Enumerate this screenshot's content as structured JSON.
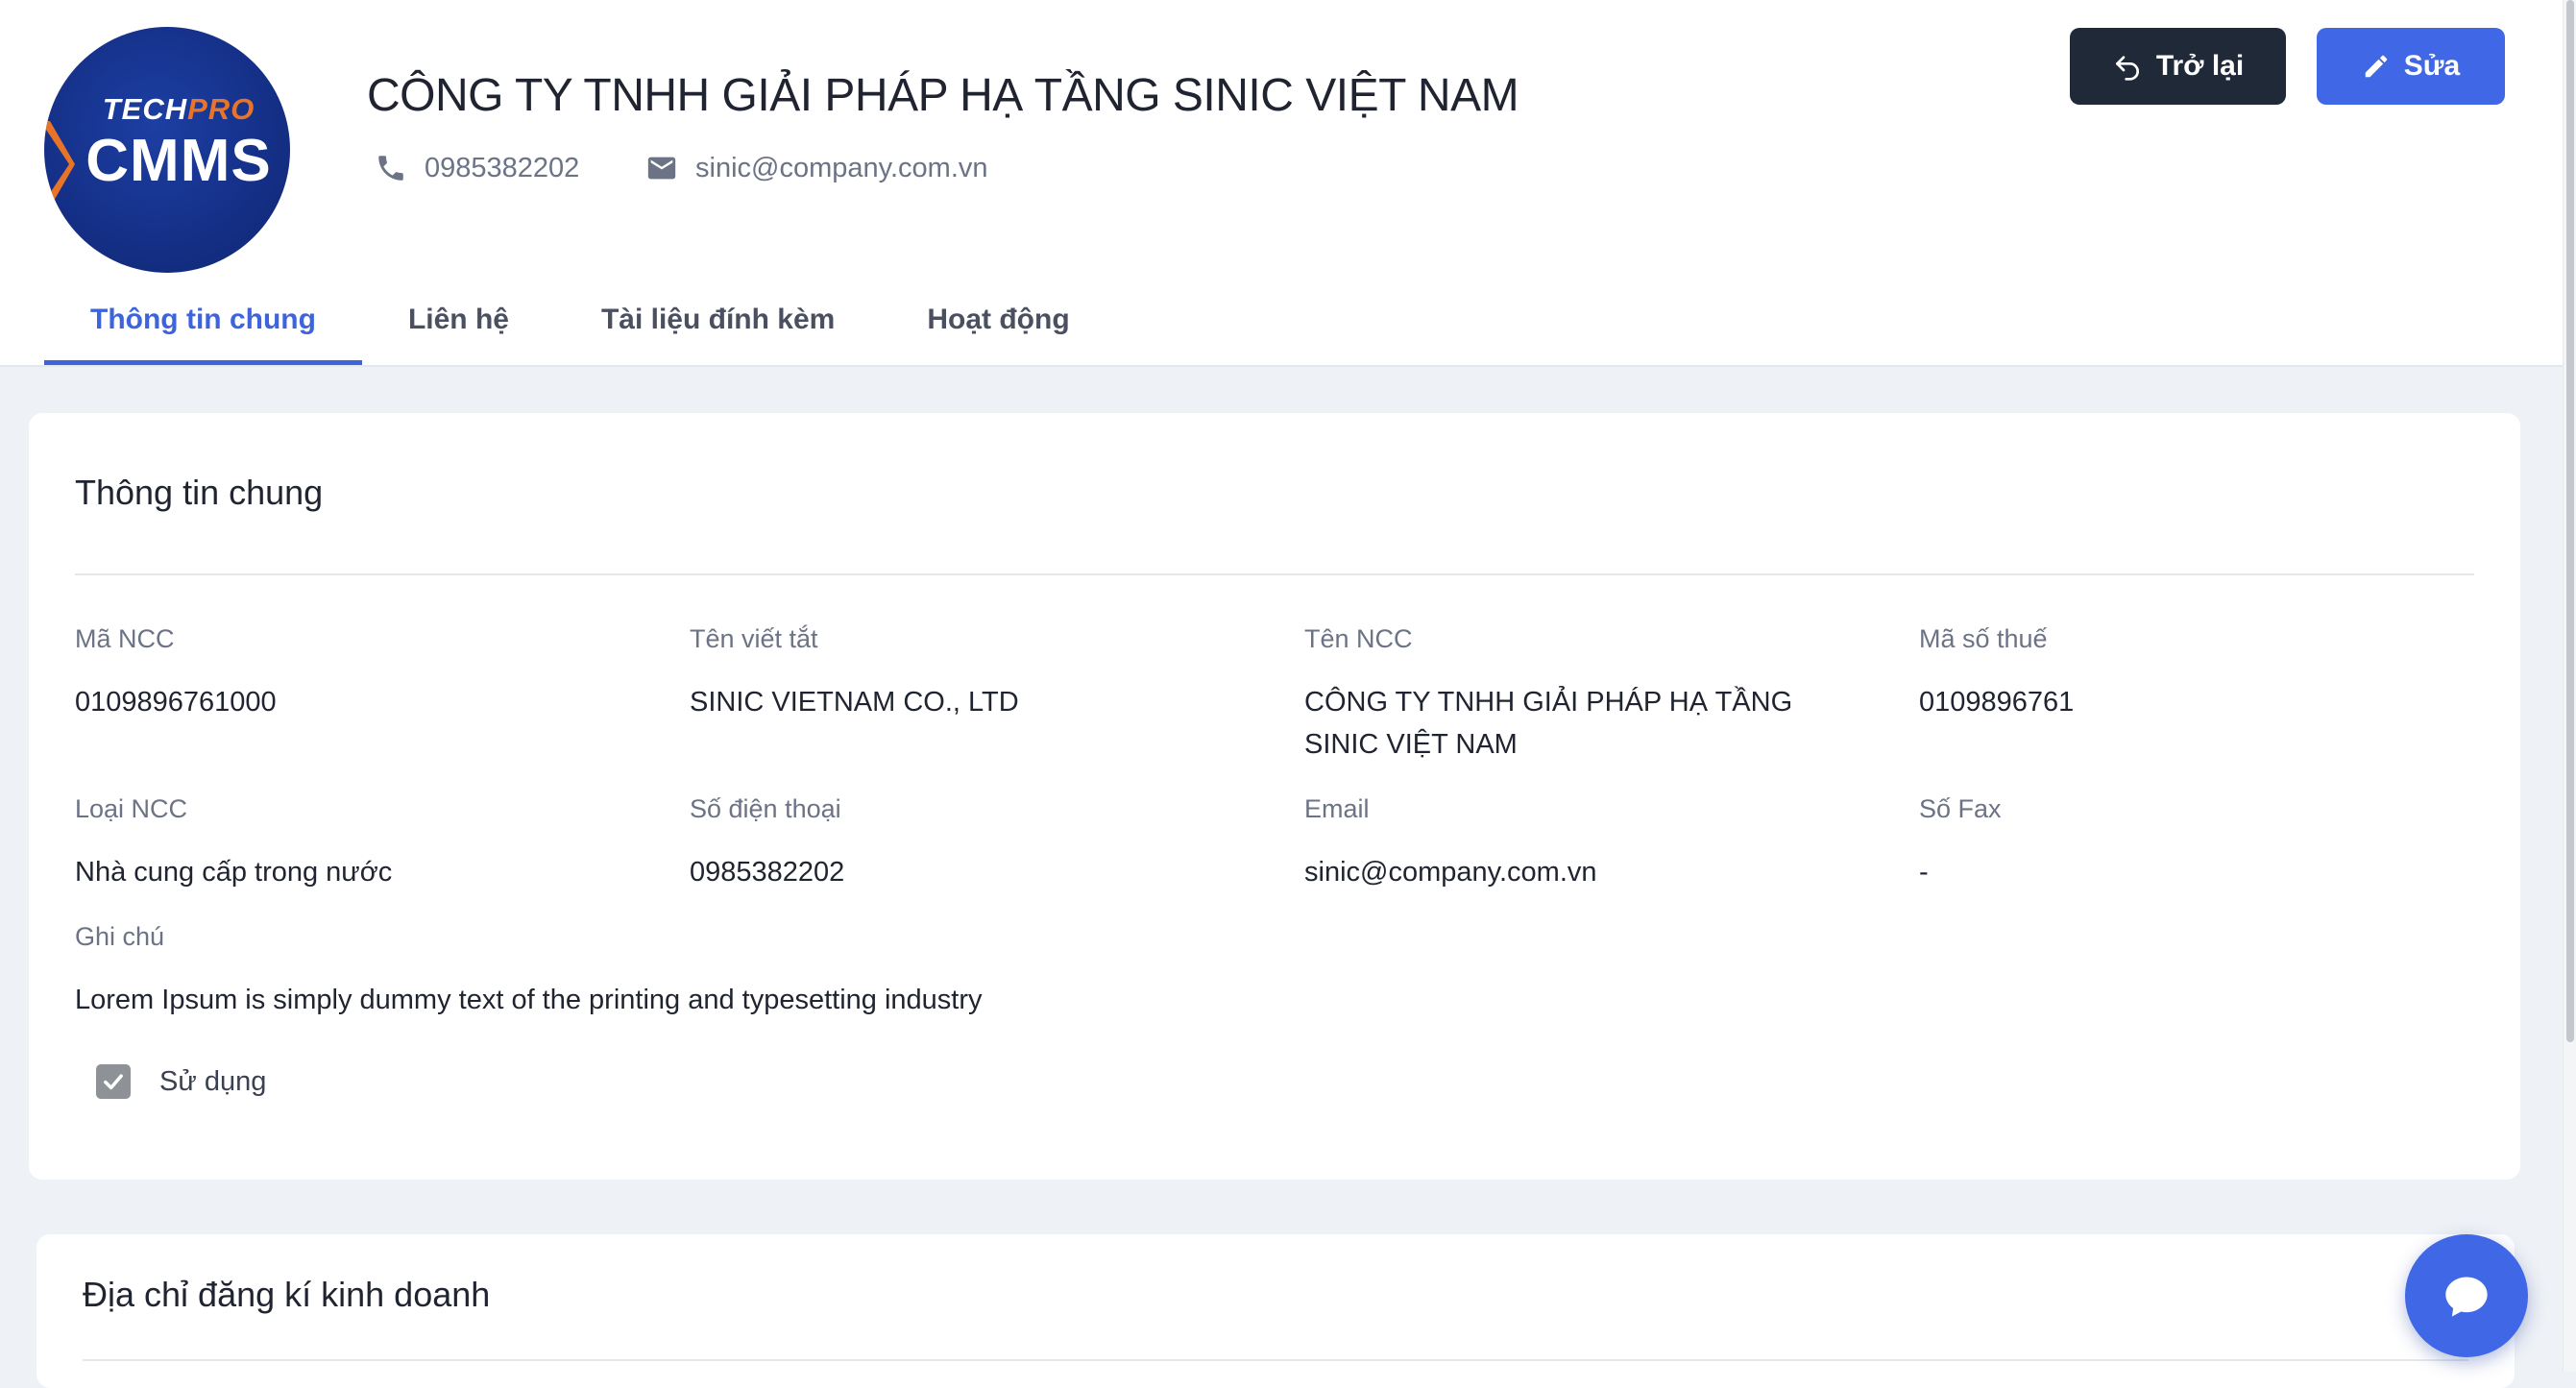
{
  "logo": {
    "line1_a": "TECH",
    "line1_b": "PRO",
    "line2": "CMMS"
  },
  "header": {
    "title": "CÔNG TY TNHH GIẢI PHÁP HẠ TẦNG SINIC VIỆT NAM",
    "phone": "0985382202",
    "email": "sinic@company.com.vn",
    "back_label": "Trở lại",
    "edit_label": "Sửa"
  },
  "tabs": [
    {
      "label": "Thông tin chung",
      "active": true
    },
    {
      "label": "Liên hệ"
    },
    {
      "label": "Tài liệu đính kèm"
    },
    {
      "label": "Hoạt động"
    }
  ],
  "general": {
    "title": "Thông tin chung",
    "fields": {
      "ma_ncc": {
        "label": "Mã NCC",
        "value": "0109896761000"
      },
      "ten_viet_tat": {
        "label": "Tên viết tắt",
        "value": "SINIC VIETNAM CO., LTD"
      },
      "ten_ncc": {
        "label": "Tên NCC",
        "value": "CÔNG TY TNHH GIẢI PHÁP HẠ TẦNG SINIC VIỆT NAM"
      },
      "ma_so_thue": {
        "label": "Mã số thuế",
        "value": "0109896761"
      },
      "loai_ncc": {
        "label": "Loại NCC",
        "value": "Nhà cung cấp trong nước"
      },
      "so_dien_thoai": {
        "label": "Số điện thoại",
        "value": "0985382202"
      },
      "email": {
        "label": "Email",
        "value": "sinic@company.com.vn"
      },
      "so_fax": {
        "label": "Số Fax",
        "value": "-"
      },
      "ghi_chu": {
        "label": "Ghi chú",
        "value": "Lorem Ipsum is simply dummy text of the printing and typesetting industry"
      }
    },
    "in_use": {
      "label": "Sử dụng",
      "checked": true
    }
  },
  "address": {
    "title": "Địa chỉ đăng kí kinh doanh"
  },
  "colors": {
    "primary": "#3f67e6",
    "dark": "#1f2937",
    "brand_orange": "#e8742a",
    "brand_blue": "#142f86"
  },
  "icons": [
    "phone-icon",
    "mail-icon",
    "undo-icon",
    "pencil-icon",
    "check-icon",
    "chat-icon"
  ]
}
